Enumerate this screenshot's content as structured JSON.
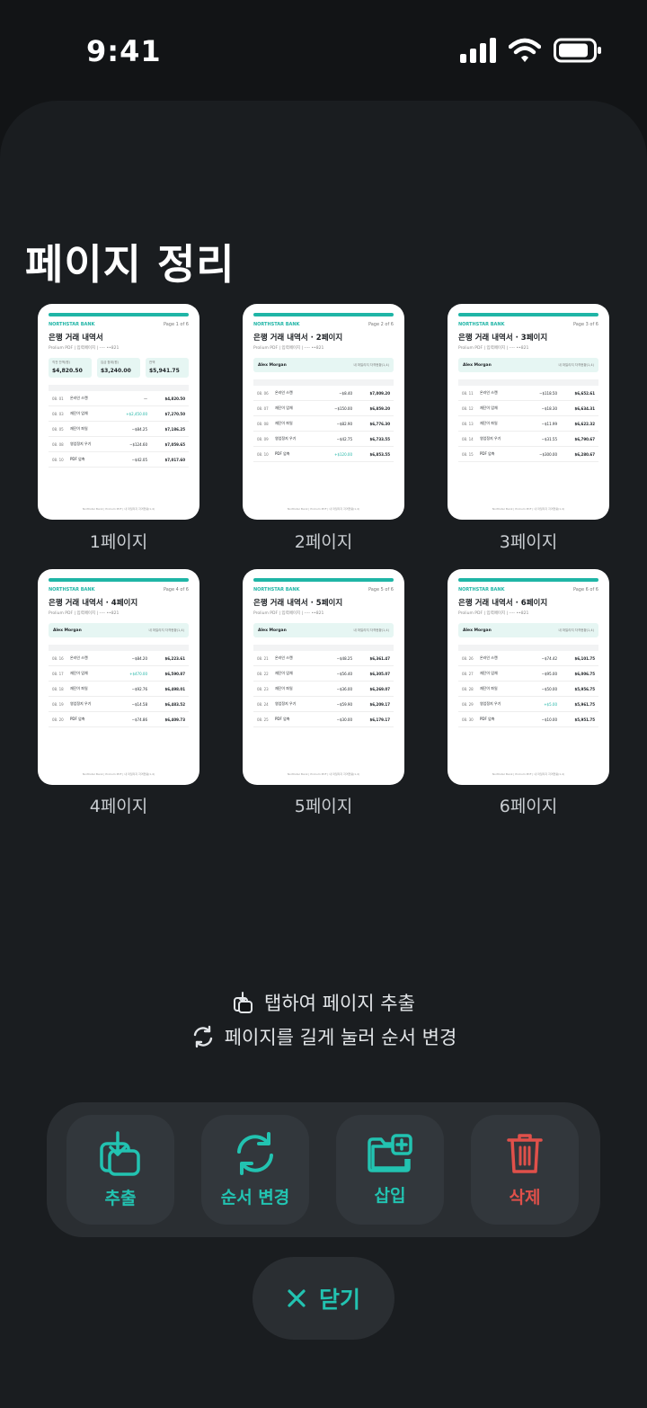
{
  "status": {
    "time": "9:41"
  },
  "title": "페이지 정리",
  "pages": [
    {
      "label": "1페이지",
      "bank": "NORTHSTAR BANK",
      "page_no": "Page 1 of 6",
      "doc_title": "은행 거래 내역서",
      "sub": "Prolium PDF | 입력페이지 | ---- ••821",
      "cards": [
        {
          "k": "직전 잔액(원)",
          "v": "$4,820.50"
        },
        {
          "k": "입금 합계(원)",
          "v": "$3,240.00"
        },
        {
          "k": "잔액",
          "v": "$5,941.75"
        }
      ],
      "rows": [
        [
          "08. 01",
          "온라인 스캔",
          "—",
          "$4,820.50"
        ],
        [
          "08. 03",
          "재단이 업체",
          "+$2,450.00",
          "$7,270.50"
        ],
        [
          "08. 05",
          "재단이 파일",
          "−$84.25",
          "$7,186.25"
        ],
        [
          "08. 08",
          "영업정지 우기",
          "−$124.60",
          "$7,059.65"
        ],
        [
          "08. 10",
          "PDF 압축",
          "−$42.05",
          "$7,017.60"
        ]
      ]
    },
    {
      "label": "2페이지",
      "bank": "NORTHSTAR BANK",
      "page_no": "Page 2 of 6",
      "doc_title": "은행 거래 내역서 · 2페이지",
      "sub": "Prolium PDF | 입력페이지 | ---- ••821",
      "account": "Alex Morgan",
      "account_desc": "내 마일리지 자격현황(1,4)",
      "rows": [
        [
          "08. 06",
          "온라인 스캔",
          "−$8.40",
          "$7,009.20"
        ],
        [
          "08. 07",
          "재단이 업체",
          "−$150.00",
          "$6,859.20"
        ],
        [
          "08. 08",
          "재단이 파일",
          "−$82.90",
          "$6,776.30"
        ],
        [
          "08. 09",
          "영업정지 우기",
          "−$42.75",
          "$6,733.55"
        ],
        [
          "08. 10",
          "PDF 압축",
          "+$120.00",
          "$6,853.55"
        ]
      ]
    },
    {
      "label": "3페이지",
      "bank": "NORTHSTAR BANK",
      "page_no": "Page 3 of 6",
      "doc_title": "은행 거래 내역서 · 3페이지",
      "sub": "Prolium PDF | 입력페이지 | ---- ••821",
      "account": "Alex Morgan",
      "account_desc": "내 마일리지 자격현황(1,4)",
      "rows": [
        [
          "08. 11",
          "온라인 스캔",
          "−$118.50",
          "$6,652.61"
        ],
        [
          "08. 12",
          "재단이 업체",
          "−$18.30",
          "$6,634.31"
        ],
        [
          "08. 13",
          "재단이 파일",
          "−$11.99",
          "$6,622.32"
        ],
        [
          "08. 14",
          "영업정지 우기",
          "−$31.55",
          "$6,790.67"
        ],
        [
          "08. 15",
          "PDF 압축",
          "−$300.00",
          "$6,280.67"
        ]
      ]
    },
    {
      "label": "4페이지",
      "bank": "NORTHSTAR BANK",
      "page_no": "Page 4 of 6",
      "doc_title": "은행 거래 내역서 · 4페이지",
      "sub": "Prolium PDF | 입력페이지 | ---- ••821",
      "account": "Alex Morgan",
      "account_desc": "내 마일리지 자격현황(1,4)",
      "rows": [
        [
          "08. 16",
          "온라인 스캔",
          "−$84.20",
          "$6,223.61"
        ],
        [
          "08. 17",
          "재단이 업체",
          "+$470.00",
          "$6,590.87"
        ],
        [
          "08. 18",
          "재단이 파일",
          "−$92.76",
          "$6,498.01"
        ],
        [
          "08. 19",
          "영업정지 우기",
          "−$14.58",
          "$6,483.52"
        ],
        [
          "08. 20",
          "PDF 압축",
          "−$74.86",
          "$6,409.73"
        ]
      ]
    },
    {
      "label": "5페이지",
      "bank": "NORTHSTAR BANK",
      "page_no": "Page 5 of 6",
      "doc_title": "은행 거래 내역서 · 5페이지",
      "sub": "Prolium PDF | 입력페이지 | ---- ••821",
      "account": "Alex Morgan",
      "account_desc": "내 마일리지 자격현황(1,4)",
      "rows": [
        [
          "08. 21",
          "온라인 스캔",
          "−$48.25",
          "$6,361.47"
        ],
        [
          "08. 22",
          "재단이 업체",
          "−$56.40",
          "$6,305.07"
        ],
        [
          "08. 23",
          "재단이 파일",
          "−$36.00",
          "$6,269.07"
        ],
        [
          "08. 24",
          "영업정지 우기",
          "−$59.90",
          "$6,209.17"
        ],
        [
          "08. 25",
          "PDF 압축",
          "−$30.00",
          "$6,179.17"
        ]
      ]
    },
    {
      "label": "6페이지",
      "bank": "NORTHSTAR BANK",
      "page_no": "Page 6 of 6",
      "doc_title": "은행 거래 내역서 · 6페이지",
      "sub": "Prolium PDF | 입력페이지 | ---- ••821",
      "account": "Alex Morgan",
      "account_desc": "내 마일리지 자격현황(1,4)",
      "rows": [
        [
          "08. 26",
          "온라인 스캔",
          "−$74.42",
          "$6,101.75"
        ],
        [
          "08. 27",
          "재단이 업체",
          "−$95.00",
          "$6,006.75"
        ],
        [
          "08. 28",
          "재단이 파일",
          "−$50.00",
          "$5,956.75"
        ],
        [
          "08. 29",
          "영업정지 우기",
          "+$5.00",
          "$5,961.75"
        ],
        [
          "08. 30",
          "PDF 압축",
          "−$10.00",
          "$5,951.75"
        ]
      ]
    }
  ],
  "footer_text": "Northstar Bank | Prolium PDF | 내 마일리지 자격현황(1,4)",
  "hints": {
    "extract": "탭하여 페이지 추출",
    "reorder": "페이지를 길게 눌러 순서 변경"
  },
  "actions": {
    "extract": "추출",
    "reorder": "순서 변경",
    "insert": "삽입",
    "delete": "삭제"
  },
  "close": "닫기",
  "colors": {
    "accent": "#22c3b1",
    "danger": "#e0504a",
    "background": "#121416",
    "sheet": "#1a1d20"
  }
}
